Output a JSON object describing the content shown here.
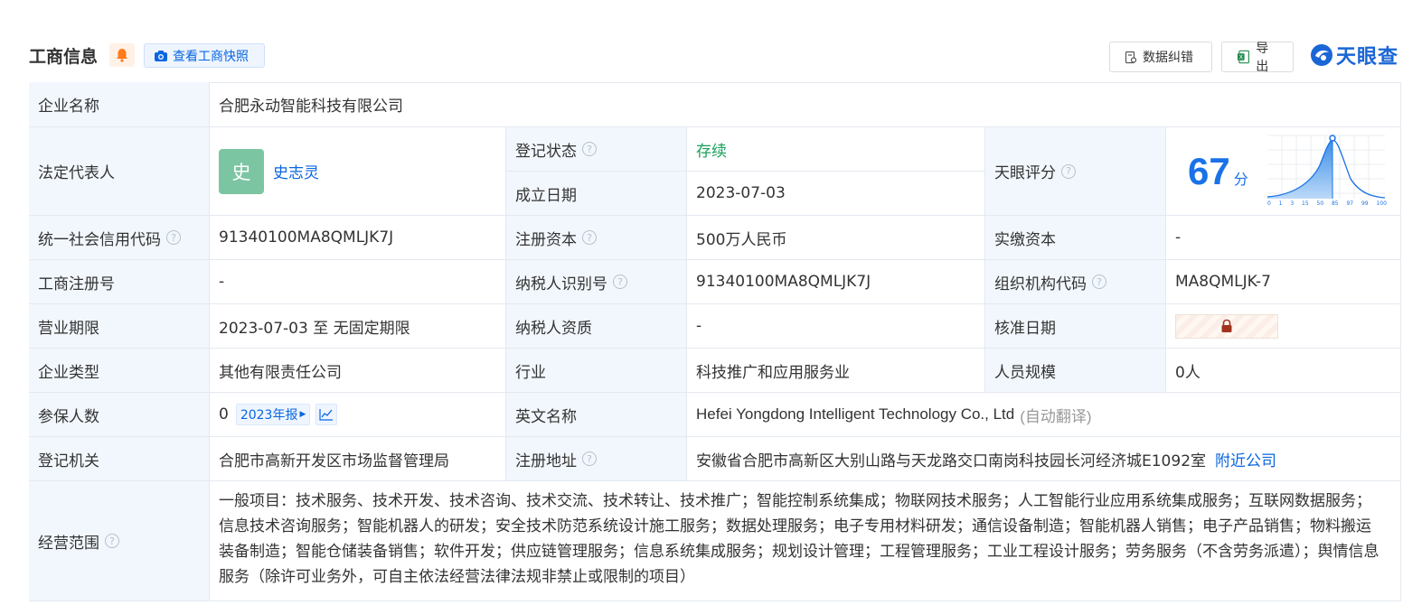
{
  "header": {
    "title": "工商信息",
    "snapshot_button": "查看工商快照",
    "data_fix_button": "数据纠错",
    "export_button": "导出",
    "logo_text": "天眼查"
  },
  "company": {
    "name_label": "企业名称",
    "name": "合肥永动智能科技有限公司",
    "legal_rep_label": "法定代表人",
    "legal_rep_avatar": "史",
    "legal_rep_name": "史志灵",
    "reg_status_label": "登记状态",
    "reg_status": "存续",
    "founded_label": "成立日期",
    "founded": "2023-07-03",
    "score_label": "天眼评分",
    "score": "67",
    "score_unit": "分",
    "score_axis": [
      "0",
      "1",
      "3",
      "15",
      "50",
      "85",
      "97",
      "99",
      "100"
    ],
    "credit_code_label": "统一社会信用代码",
    "credit_code": "91340100MA8QMLJK7J",
    "reg_capital_label": "注册资本",
    "reg_capital": "500万人民币",
    "paid_capital_label": "实缴资本",
    "paid_capital": "-",
    "reg_no_label": "工商注册号",
    "reg_no": "-",
    "taxpayer_id_label": "纳税人识别号",
    "taxpayer_id": "91340100MA8QMLJK7J",
    "org_code_label": "组织机构代码",
    "org_code": "MA8QMLJK-7",
    "term_label": "营业期限",
    "term": "2023-07-03 至 无固定期限",
    "taxpayer_qual_label": "纳税人资质",
    "taxpayer_qual": "-",
    "approve_date_label": "核准日期",
    "type_label": "企业类型",
    "type": "其他有限责任公司",
    "industry_label": "行业",
    "industry": "科技推广和应用服务业",
    "staff_label": "人员规模",
    "staff": "0人",
    "insured_label": "参保人数",
    "insured": "0",
    "insured_report": "2023年报",
    "english_label": "英文名称",
    "english_name": "Hefei Yongdong Intelligent Technology Co., Ltd",
    "english_note": "(自动翻译)",
    "authority_label": "登记机关",
    "authority": "合肥市高新开发区市场监督管理局",
    "address_label": "注册地址",
    "address": "安徽省合肥市高新区大别山路与天龙路交口南岗科技园长河经济城E1092室",
    "nearby_link": "附近公司",
    "scope_label": "经营范围",
    "scope": "一般项目：技术服务、技术开发、技术咨询、技术交流、技术转让、技术推广；智能控制系统集成；物联网技术服务；人工智能行业应用系统集成服务；互联网数据服务；信息技术咨询服务；智能机器人的研发；安全技术防范系统设计施工服务；数据处理服务；电子专用材料研发；通信设备制造；智能机器人销售；电子产品销售；物料搬运装备制造；智能仓储装备销售；软件开发；供应链管理服务；信息系统集成服务；规划设计管理；工程管理服务；工业工程设计服务；劳务服务（不含劳务派遣）；舆情信息服务（除许可业务外，可自主依法经营法律法规非禁止或限制的项目）"
  }
}
